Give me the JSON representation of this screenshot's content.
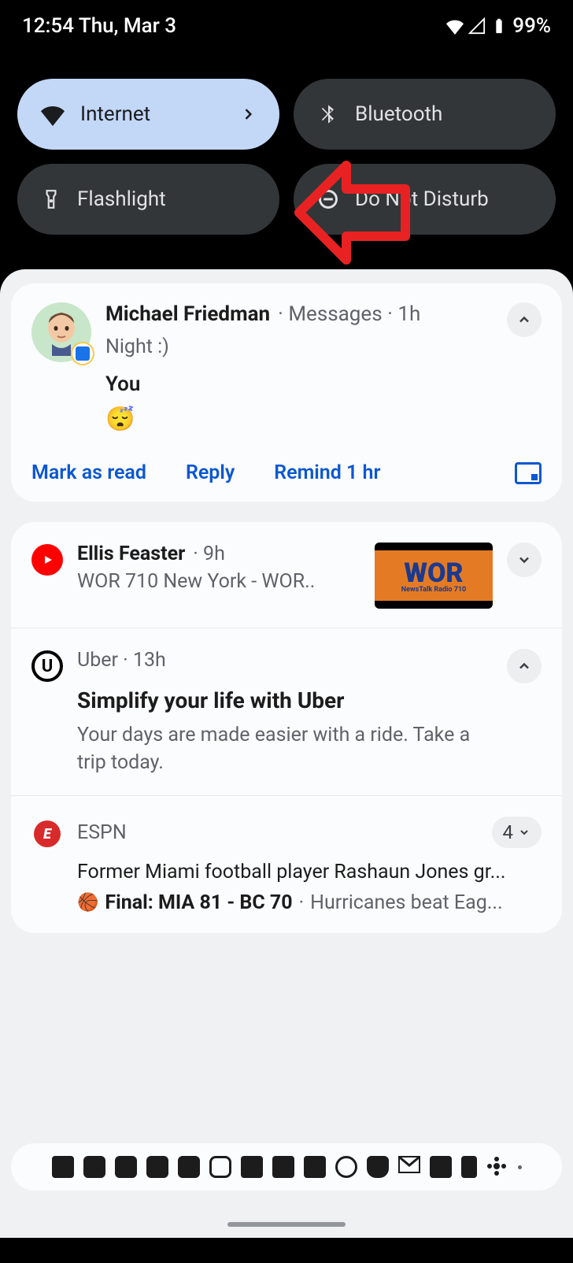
{
  "status": {
    "time": "12:54",
    "date": "Thu, Mar 3",
    "battery": "99%"
  },
  "qs": {
    "internet": "Internet",
    "bluetooth": "Bluetooth",
    "flashlight": "Flashlight",
    "dnd": "Do Not Disturb"
  },
  "notifications": {
    "conversation": {
      "sender": "Michael Friedman",
      "app": "Messages",
      "time": "1h",
      "msg1": "Night :)",
      "you": "You",
      "emoji": "😴",
      "actions": {
        "mark": "Mark as read",
        "reply": "Reply",
        "remind": "Remind 1 hr"
      }
    },
    "youtube": {
      "channel": "Ellis Feaster",
      "time": "9h",
      "title": "WOR 710 New York - WOR..",
      "thumb_text": "WOR",
      "thumb_sub": "NewsTalk Radio 710"
    },
    "uber": {
      "app": "Uber",
      "time": "13h",
      "heading": "Simplify your life with Uber",
      "desc": "Your days are made easier with a ride. Take a trip today."
    },
    "espn": {
      "app": "ESPN",
      "count": "4",
      "line1": "Former Miami football player Rashaun Jones gr...",
      "score": "Final: MIA 81 - BC 70",
      "line2_tail": "Hurricanes beat Eag..."
    }
  }
}
